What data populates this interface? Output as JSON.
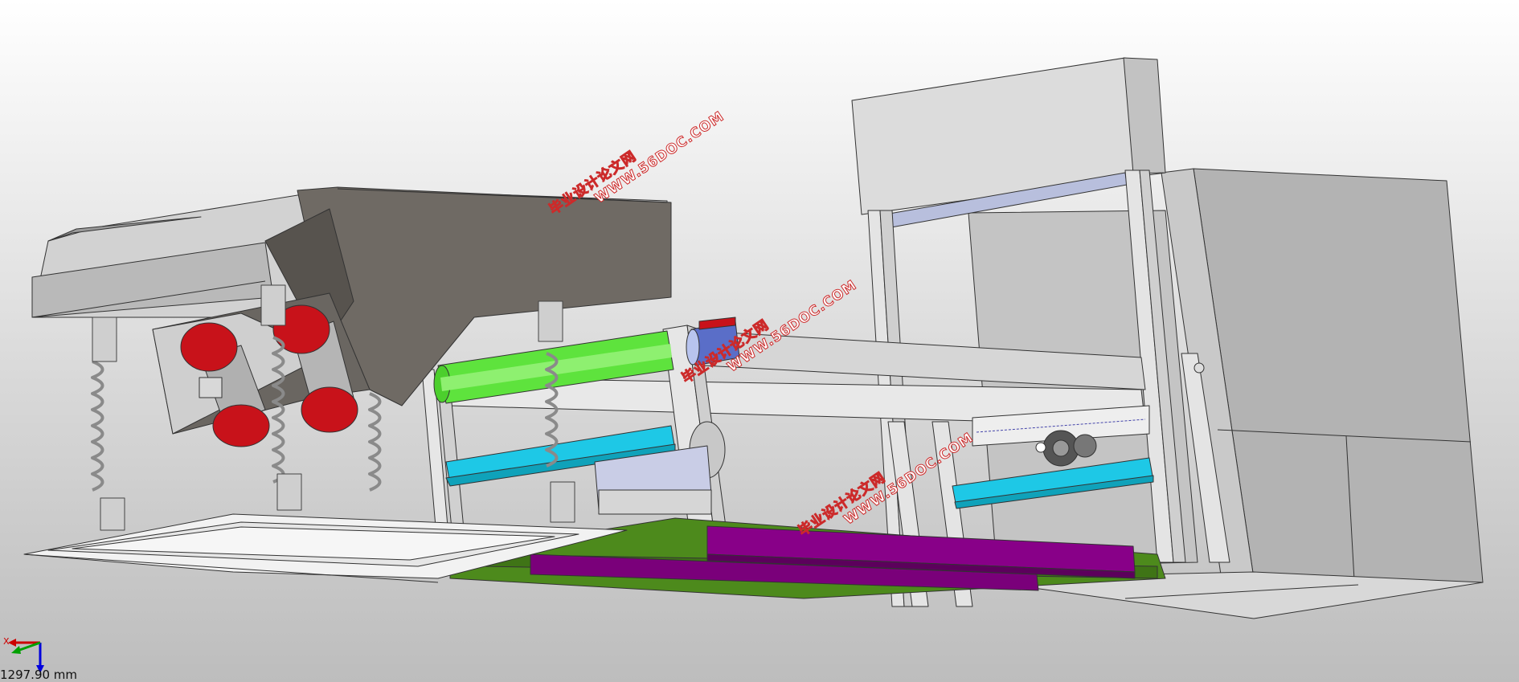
{
  "viewport": {
    "scale_readout": "1297.90 mm"
  },
  "triad": {
    "x_label": "X",
    "x_color": "#cc0000",
    "y_color": "#00a000",
    "z_color": "#0000dd"
  },
  "watermarks": [
    {
      "cn": "毕业设计论文网",
      "url": "WWW.56DOC.COM"
    },
    {
      "cn": "毕业设计论文网",
      "url": "WWW.56DOC.COM"
    },
    {
      "cn": "毕业设计论文网",
      "url": "WWW.56DOC.COM"
    }
  ],
  "colors": {
    "hopper": "#6f6a64",
    "motor_red": "#c8121a",
    "roller_green": "#5ee33d",
    "rail_cyan": "#1ec8e6",
    "rail_purple": "#8a0a8a",
    "base_green": "#4a8a1a",
    "frame_grey": "#e2e2e2",
    "cabinet_grey": "#b4b4b4"
  }
}
